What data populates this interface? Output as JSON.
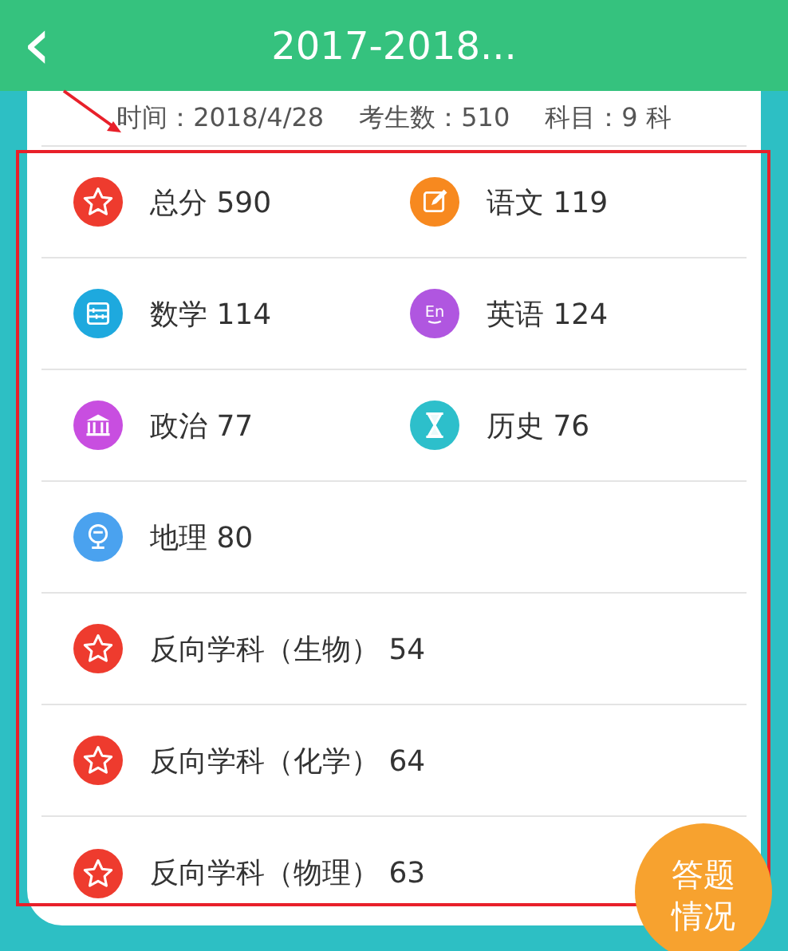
{
  "header": {
    "back_icon": "‹",
    "title": "2017-2018..."
  },
  "info": {
    "time": "时间：2018/4/28",
    "students": "考生数：510",
    "subjects": "科目：9 科"
  },
  "rows": [
    {
      "cells": [
        {
          "kind": "star",
          "color": "#ee3b2e",
          "text": "总分 590"
        },
        {
          "kind": "edit",
          "color": "#f7891f",
          "text": "语文 119"
        }
      ]
    },
    {
      "cells": [
        {
          "kind": "abacus",
          "color": "#1ea9de",
          "text": "数学 114"
        },
        {
          "kind": "letters",
          "icon_text": "En",
          "color": "#b056e0",
          "text": "英语 124"
        }
      ]
    },
    {
      "cells": [
        {
          "kind": "building",
          "color": "#c84ee0",
          "text": "政治 77"
        },
        {
          "kind": "hourglass",
          "color": "#2dbfcb",
          "text": "历史 76"
        }
      ]
    },
    {
      "cells": [
        {
          "kind": "globe",
          "color": "#4aa2ef",
          "text": "地理 80"
        }
      ]
    },
    {
      "cells": [
        {
          "kind": "star",
          "color": "#ee3b2e",
          "text": "反向学科（生物） 54"
        }
      ]
    },
    {
      "cells": [
        {
          "kind": "star",
          "color": "#ee3b2e",
          "text": "反向学科（化学） 64"
        }
      ]
    },
    {
      "cells": [
        {
          "kind": "star",
          "color": "#ee3b2e",
          "text": "反向学科（物理） 63"
        }
      ]
    }
  ],
  "fab": {
    "label": "答题情况"
  },
  "annotation": {
    "kind": "highlight-box"
  }
}
